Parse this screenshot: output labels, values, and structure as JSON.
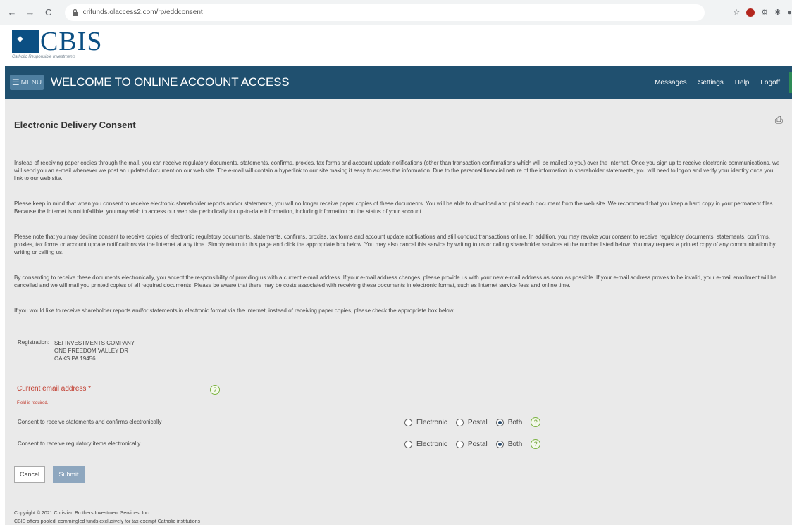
{
  "browser": {
    "back": "←",
    "forward": "→",
    "reload": "C",
    "url": "crifunds.olaccess2.com/rp/eddconsent",
    "lock": "🔒"
  },
  "logo": {
    "text": "CBIS",
    "subtitle": "Catholic Responsible Investments"
  },
  "header": {
    "menu_label": "MENU",
    "title": "WELCOME TO ONLINE ACCOUNT ACCESS",
    "links": [
      "Messages",
      "Settings",
      "Help",
      "Logoff"
    ]
  },
  "page": {
    "title": "Electronic Delivery Consent",
    "paragraphs": [
      "Instead of receiving paper copies through the mail, you can receive regulatory documents, statements, confirms, proxies, tax forms and account update notifications (other than transaction confirmations which will be mailed to you) over the Internet. Once you sign up to receive electronic communications, we will send you an e-mail whenever we post an updated document on our web site. The e-mail will contain a hyperlink to our site making it easy to access the information. Due to the personal financial nature of the information in shareholder statements, you will need to logon and verify your identity once you link to our web site.",
      "Please keep in mind that when you consent to receive electronic shareholder reports and/or statements, you will no longer receive paper copies of these documents. You will be able to download and print each document from the web site. We recommend that you keep a hard copy in your permanent files. Because the Internet is not infallible, you may wish to access our web site periodically for up-to-date information, including information on the status of your account.",
      "Please note that you may decline consent to receive copies of electronic regulatory documents, statements, confirms, proxies, tax forms and account update notifications and still conduct transactions online. In addition, you may revoke your consent to receive regulatory documents, statements, confirms, proxies, tax forms or account update notifications via the Internet at any time. Simply return to this page and click the appropriate box below. You may also cancel this service by writing to us or calling shareholder services at the number listed below. You may request a printed copy of any communication by writing or calling us.",
      "By consenting to receive these documents electronically, you accept the responsibility of providing us with a current e-mail address. If your e-mail address changes, please provide us with your new e-mail address as soon as possible. If your e-mail address proves to be invalid, your e-mail enrollment will be cancelled and we will mail you printed copies of all required documents. Please be aware that there may be costs associated with receiving these documents in electronic format, such as Internet service fees and online time.",
      "If you would like to receive shareholder reports and/or statements in electronic format via the Internet, instead of receiving paper copies, please check the appropriate box below."
    ],
    "registration_label": "Registration:",
    "registration_lines": [
      "SEI INVESTMENTS COMPANY",
      "ONE FREEDOM VALLEY DR",
      "OAKS PA 19456"
    ],
    "email_placeholder": "Current email address *",
    "email_value": "",
    "email_error": "Field is required.",
    "consents": [
      {
        "label": "Consent to receive statements and confirms electronically",
        "options": [
          "Electronic",
          "Postal",
          "Both"
        ],
        "selected": "Both"
      },
      {
        "label": "Consent to receive regulatory items electronically",
        "options": [
          "Electronic",
          "Postal",
          "Both"
        ],
        "selected": "Both"
      }
    ],
    "cancel_label": "Cancel",
    "submit_label": "Submit",
    "help_glyph": "?",
    "print_glyph": "⎙"
  },
  "footer": {
    "copyright": "Copyright © 2021 Christian Brothers Investment Services, Inc.",
    "note": "CBIS offers pooled, commingled funds exclusively for tax-exempt Catholic institutions"
  },
  "colors": {
    "header_bg": "#20506f",
    "brand_blue": "#0b4f83",
    "error_red": "#c0392b",
    "help_green": "#7cb342",
    "content_bg": "#eaeaea"
  }
}
